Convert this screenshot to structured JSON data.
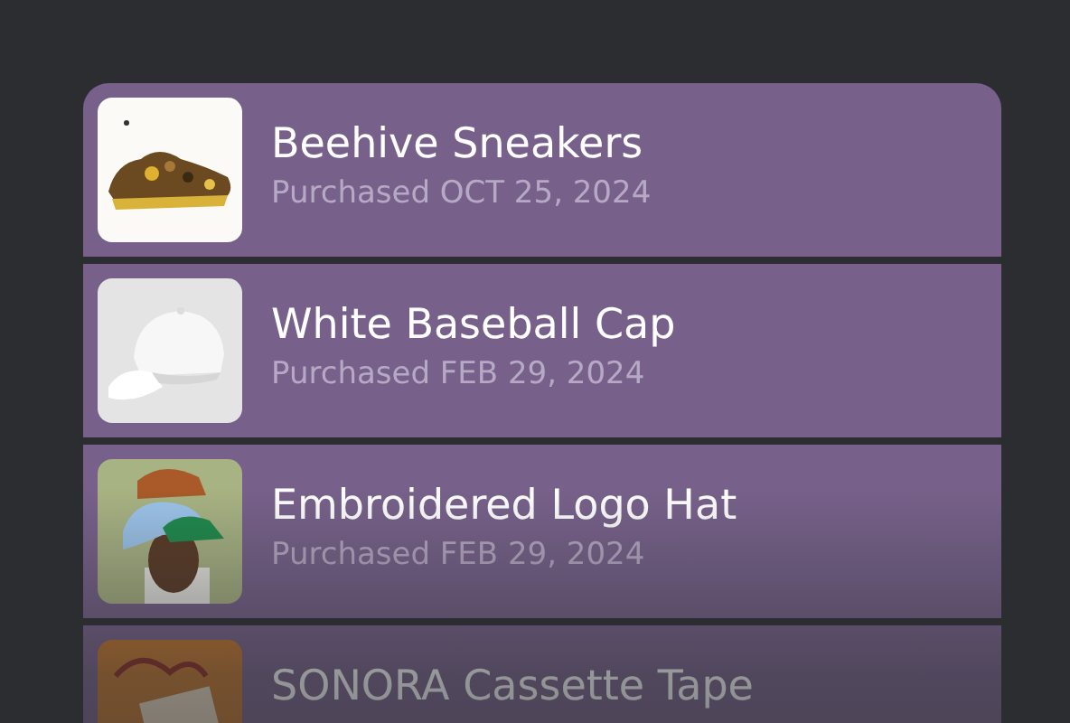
{
  "purchases": [
    {
      "title": "Beehive Sneakers",
      "subtitle": "Purchased OCT 25, 2024"
    },
    {
      "title": "White Baseball Cap",
      "subtitle": "Purchased FEB 29, 2024"
    },
    {
      "title": "Embroidered Logo Hat",
      "subtitle": "Purchased FEB 29, 2024"
    },
    {
      "title": "SONORA Cassette Tape"
    }
  ]
}
